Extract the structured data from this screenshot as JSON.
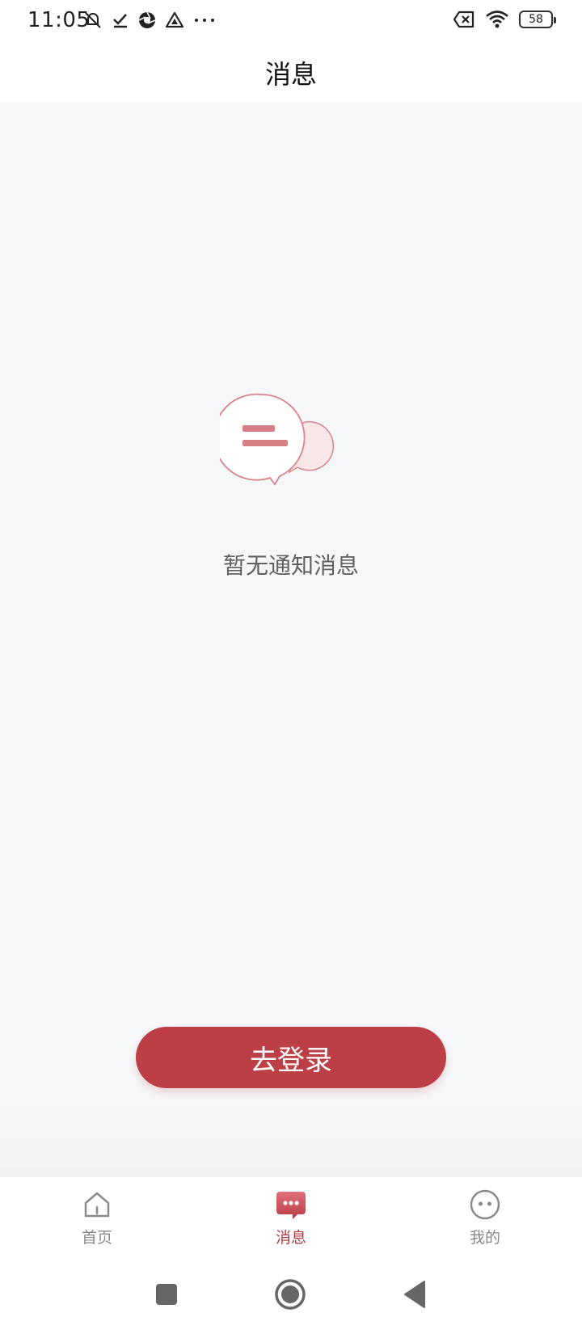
{
  "status_bar": {
    "time": "11:05",
    "battery_level": "58",
    "icons": [
      "silent-icon",
      "check-icon",
      "aperture-icon",
      "drive-icon",
      "more-icon",
      "no-sim-icon",
      "wifi-icon",
      "battery-icon"
    ]
  },
  "header": {
    "title": "消息"
  },
  "empty_state": {
    "icon": "chat-bubbles-icon",
    "message": "暂无通知消息"
  },
  "actions": {
    "login_label": "去登录"
  },
  "tabbar": {
    "items": [
      {
        "label": "首页",
        "icon": "home-icon",
        "active": false
      },
      {
        "label": "消息",
        "icon": "message-icon",
        "active": true
      },
      {
        "label": "我的",
        "icon": "profile-icon",
        "active": false
      }
    ]
  },
  "system_nav": {
    "buttons": [
      "recents-button",
      "home-button",
      "back-button"
    ]
  },
  "colors": {
    "accent": "#bd3f46",
    "background": "#f6f7f9",
    "text_muted": "#5f5f5f"
  }
}
